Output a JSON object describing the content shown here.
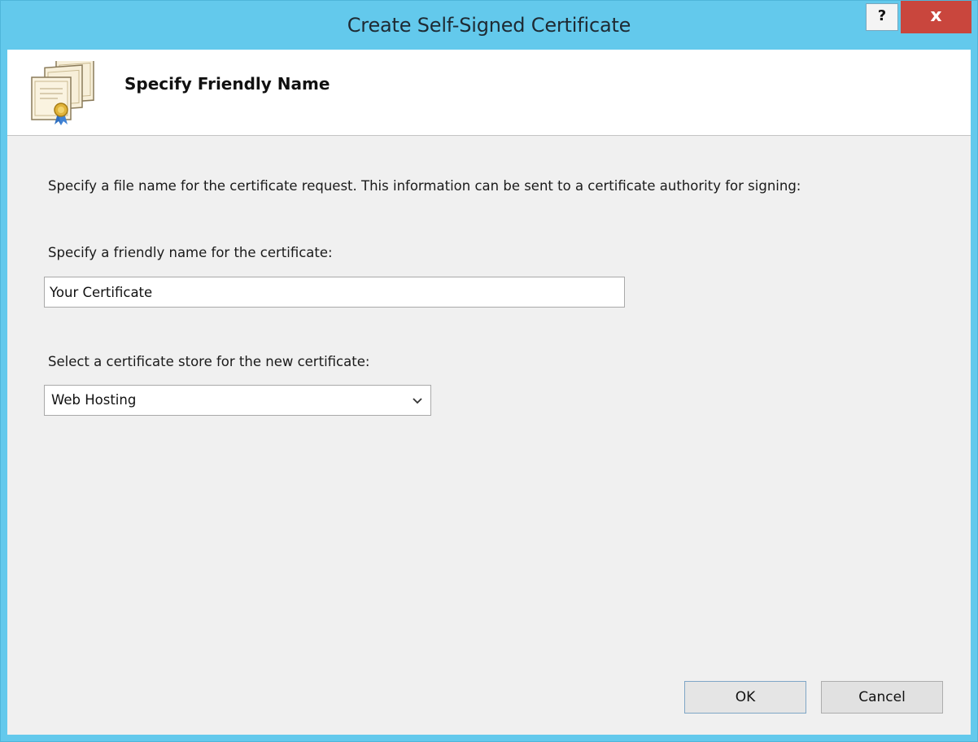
{
  "window": {
    "title": "Create Self-Signed Certificate",
    "help_label": "?",
    "close_label": "x"
  },
  "header": {
    "title": "Specify Friendly Name",
    "icon": "certificate-stack-icon"
  },
  "content": {
    "description": "Specify a file name for the certificate request.  This information can be sent to a certificate authority for signing:",
    "friendly_name_label": "Specify a friendly name for the certificate:",
    "friendly_name_value": "Your Certificate",
    "store_label": "Select a certificate store for the new certificate:",
    "store_value": "Web Hosting"
  },
  "buttons": {
    "ok": "OK",
    "cancel": "Cancel"
  },
  "colors": {
    "titlebar": "#63c9ec",
    "close_button": "#c9463d",
    "content_bg": "#f0f0f0"
  }
}
